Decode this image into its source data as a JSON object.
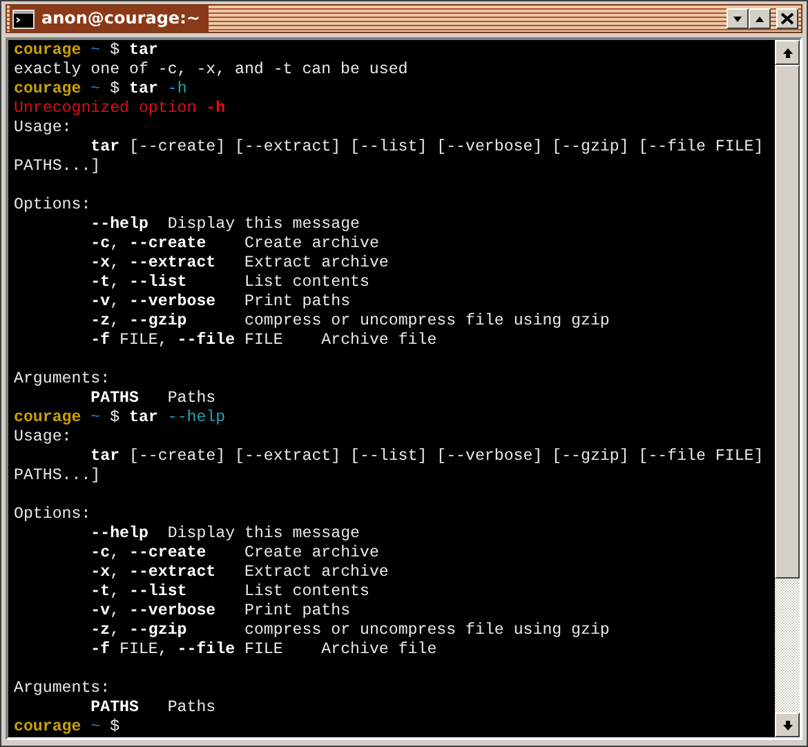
{
  "window": {
    "title": "anon@courage:~"
  },
  "lines": [
    {
      "kind": "prompt",
      "segments": [
        {
          "kind": "host",
          "text": "courage"
        },
        {
          "kind": "path",
          "text": "~"
        },
        {
          "kind": "symbol",
          "text": "$"
        },
        {
          "kind": "command",
          "text": "tar"
        }
      ]
    },
    {
      "kind": "output",
      "text": "exactly one of -c, -x, and -t can be used"
    },
    {
      "kind": "prompt",
      "segments": [
        {
          "kind": "host",
          "text": "courage"
        },
        {
          "kind": "path",
          "text": "~"
        },
        {
          "kind": "symbol",
          "text": "$"
        },
        {
          "kind": "command",
          "text": "tar"
        },
        {
          "kind": "arg",
          "text": "-h"
        }
      ]
    },
    {
      "kind": "error",
      "text": "Unrecognized option **-h**"
    },
    {
      "kind": "output",
      "text": "Usage:"
    },
    {
      "kind": "output",
      "text": "        **tar** [--create] [--extract] [--list] [--verbose] [--gzip] [--file FILE]"
    },
    {
      "kind": "output",
      "text": "PATHS...]"
    },
    {
      "kind": "blank"
    },
    {
      "kind": "output",
      "text": "Options:"
    },
    {
      "kind": "output",
      "text": "        **--help**  Display this message"
    },
    {
      "kind": "output",
      "text": "        **-c**, **--create**    Create archive"
    },
    {
      "kind": "output",
      "text": "        **-x**, **--extract**   Extract archive"
    },
    {
      "kind": "output",
      "text": "        **-t**, **--list**      List contents"
    },
    {
      "kind": "output",
      "text": "        **-v**, **--verbose**   Print paths"
    },
    {
      "kind": "output",
      "text": "        **-z**, **--gzip**      compress or uncompress file using gzip"
    },
    {
      "kind": "output",
      "text": "        **-f** FILE, **--file** FILE    Archive file"
    },
    {
      "kind": "blank"
    },
    {
      "kind": "output",
      "text": "Arguments:"
    },
    {
      "kind": "output",
      "text": "        **PATHS**   Paths"
    },
    {
      "kind": "prompt",
      "segments": [
        {
          "kind": "host",
          "text": "courage"
        },
        {
          "kind": "path",
          "text": "~"
        },
        {
          "kind": "symbol",
          "text": "$"
        },
        {
          "kind": "command",
          "text": "tar"
        },
        {
          "kind": "arg",
          "text": "--help"
        }
      ]
    },
    {
      "kind": "output",
      "text": "Usage:"
    },
    {
      "kind": "output",
      "text": "        **tar** [--create] [--extract] [--list] [--verbose] [--gzip] [--file FILE]"
    },
    {
      "kind": "output",
      "text": "PATHS...]"
    },
    {
      "kind": "blank"
    },
    {
      "kind": "output",
      "text": "Options:"
    },
    {
      "kind": "output",
      "text": "        **--help**  Display this message"
    },
    {
      "kind": "output",
      "text": "        **-c**, **--create**    Create archive"
    },
    {
      "kind": "output",
      "text": "        **-x**, **--extract**   Extract archive"
    },
    {
      "kind": "output",
      "text": "        **-t**, **--list**      List contents"
    },
    {
      "kind": "output",
      "text": "        **-v**, **--verbose**   Print paths"
    },
    {
      "kind": "output",
      "text": "        **-z**, **--gzip**      compress or uncompress file using gzip"
    },
    {
      "kind": "output",
      "text": "        **-f** FILE, **--file** FILE    Archive file"
    },
    {
      "kind": "blank"
    },
    {
      "kind": "output",
      "text": "Arguments:"
    },
    {
      "kind": "output",
      "text": "        **PATHS**   Paths"
    },
    {
      "kind": "prompt",
      "segments": [
        {
          "kind": "host",
          "text": "courage"
        },
        {
          "kind": "path",
          "text": "~"
        },
        {
          "kind": "symbol",
          "text": "$"
        }
      ]
    }
  ]
}
